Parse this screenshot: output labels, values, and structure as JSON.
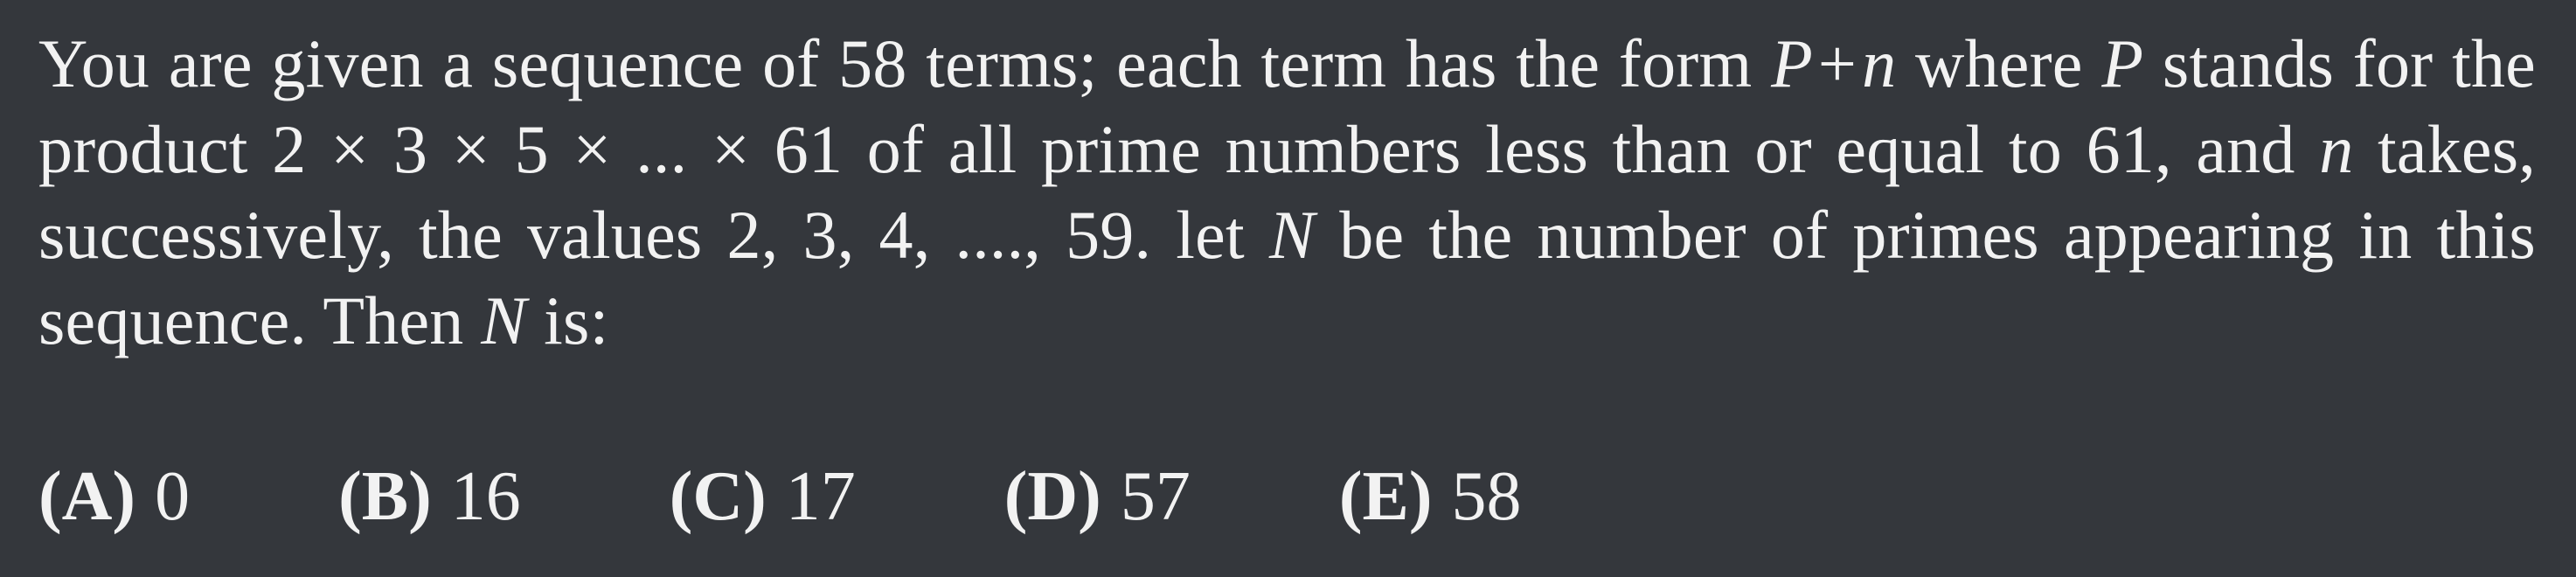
{
  "problem": {
    "seg1": "You are given a sequence of 58 terms; each term has the form ",
    "m_P1": "P",
    "m_plus": "+",
    "m_n1": "n",
    "seg2": " where ",
    "m_P2": "P",
    "seg3": " stands for the product 2 × 3 × 5 × ... × 61 of all prime numbers less than or equal to 61, and ",
    "m_n2": "n",
    "seg4": " takes, successively, the values 2, 3, 4, ...., 59.  let ",
    "m_N1": "N",
    "seg5": " be the number of primes appearing in this sequence. Then ",
    "m_N2": "N",
    "seg6": " is:"
  },
  "choices": [
    {
      "letter": "(A)",
      "value": "0"
    },
    {
      "letter": "(B)",
      "value": "16"
    },
    {
      "letter": "(C)",
      "value": "17"
    },
    {
      "letter": "(D)",
      "value": "57"
    },
    {
      "letter": "(E)",
      "value": "58"
    }
  ],
  "colors": {
    "background": "#34373c",
    "text": "#f2f2f2"
  }
}
